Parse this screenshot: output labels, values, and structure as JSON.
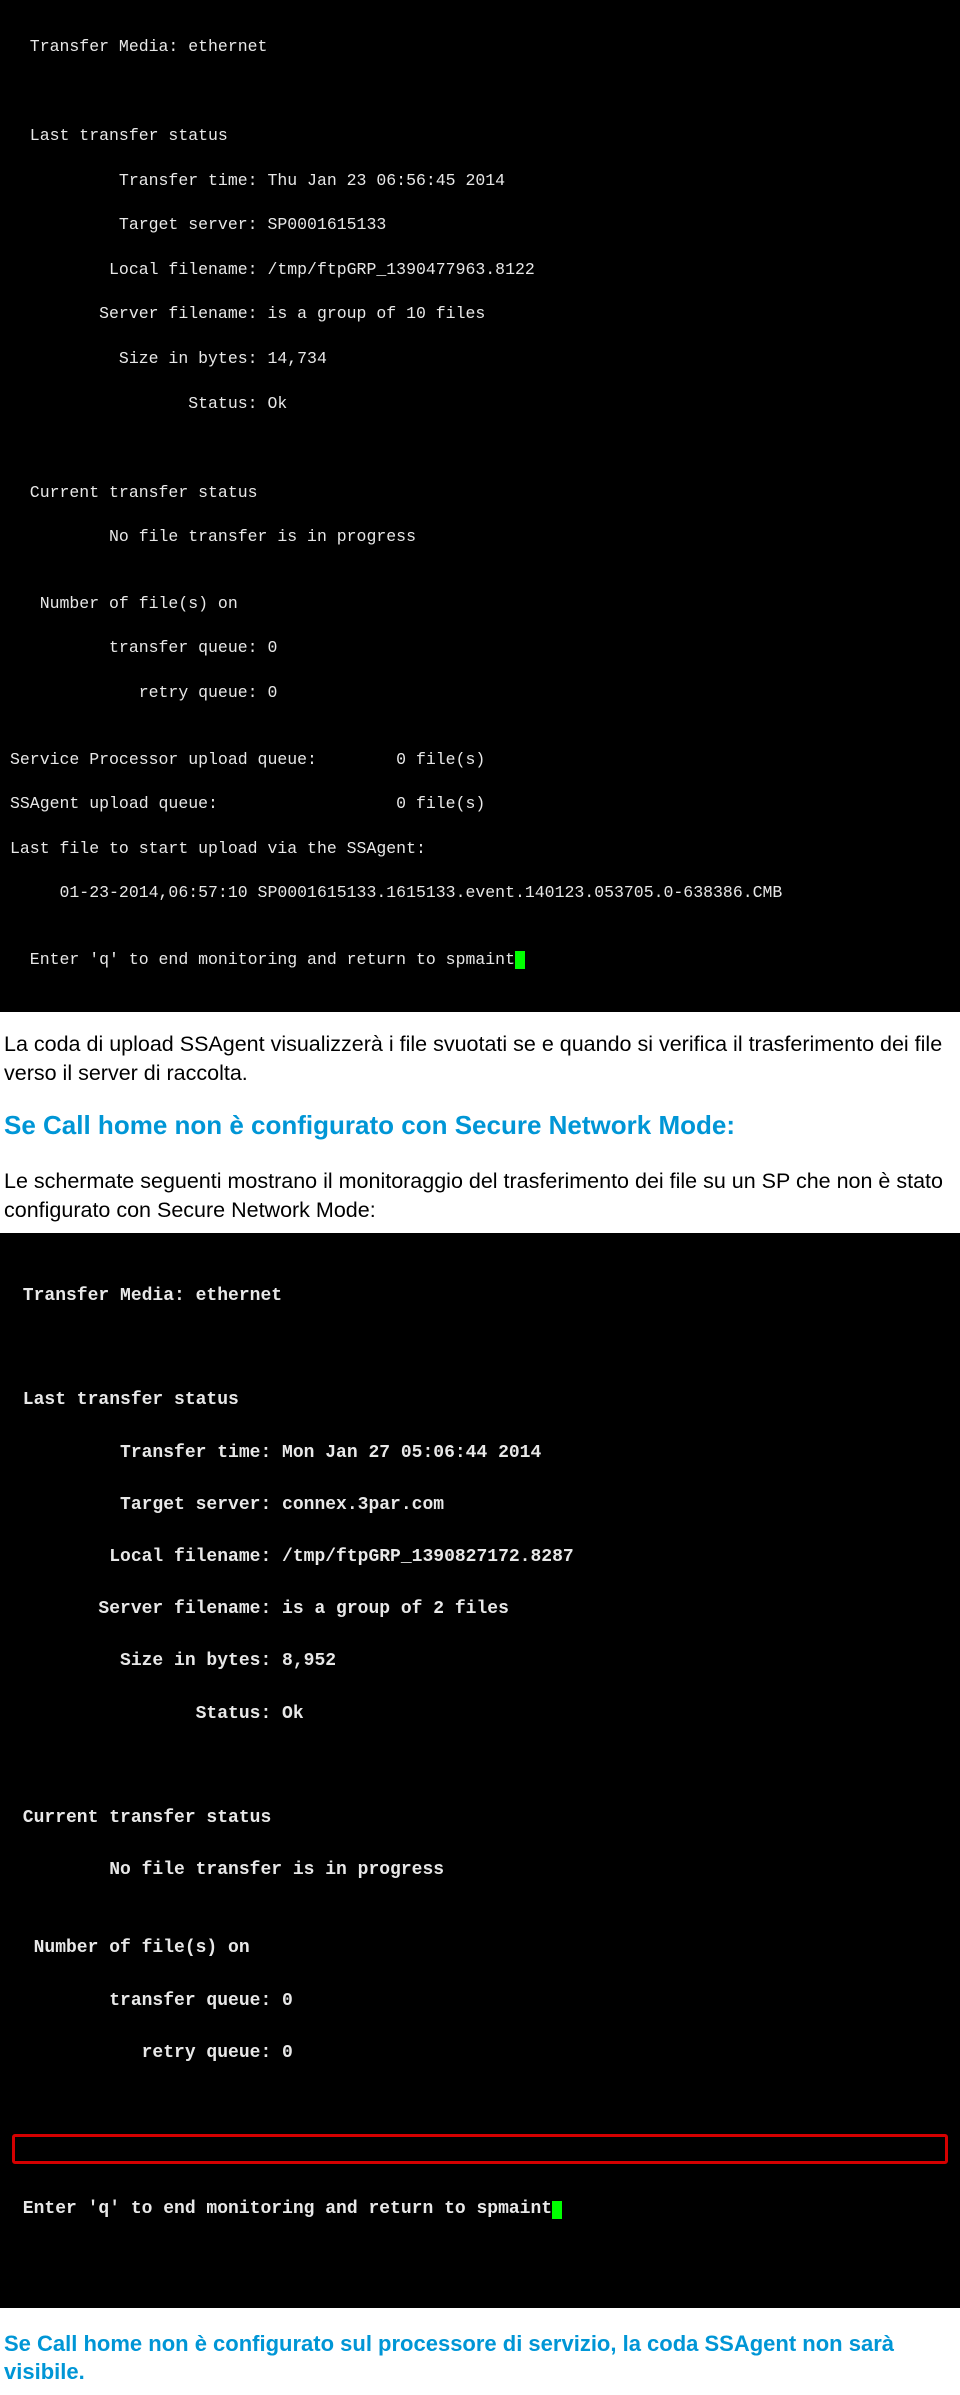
{
  "terminal1": {
    "rows": [
      "  Transfer Media: ethernet",
      "",
      "",
      "  Last transfer status",
      "           Transfer time: Thu Jan 23 06:56:45 2014",
      "           Target server: SP0001615133",
      "          Local filename: /tmp/ftpGRP_1390477963.8122",
      "         Server filename: is a group of 10 files",
      "           Size in bytes: 14,734",
      "                  Status: Ok",
      "",
      "",
      "  Current transfer status",
      "          No file transfer is in progress",
      "",
      "   Number of file(s) on",
      "          transfer queue: 0",
      "             retry queue: 0",
      "",
      "Service Processor upload queue:        0 file(s)",
      "SSAgent upload queue:                  0 file(s)",
      "Last file to start upload via the SSAgent:",
      "     01-23-2014,06:57:10 SP0001615133.1615133.event.140123.053705.0-638386.CMB",
      ""
    ],
    "prompt": "  Enter 'q' to end monitoring and return to spmaint"
  },
  "paragraph1": "La coda di upload SSAgent visualizzerà i file svuotati se e quando si verifica il trasferimento dei file verso il server di raccolta.",
  "heading1": "Se Call home non è configurato con Secure Network Mode:",
  "paragraph2": "Le schermate seguenti mostrano il monitoraggio del trasferimento dei file su un SP che non è stato configurato con Secure Network Mode:",
  "terminal2": {
    "rows": [
      " Transfer Media: ethernet",
      "",
      "",
      " Last transfer status",
      "          Transfer time: Mon Jan 27 05:06:44 2014",
      "          Target server: connex.3par.com",
      "         Local filename: /tmp/ftpGRP_1390827172.8287",
      "        Server filename: is a group of 2 files",
      "          Size in bytes: 8,952",
      "                 Status: Ok",
      "",
      "",
      " Current transfer status",
      "         No file transfer is in progress",
      "",
      "  Number of file(s) on",
      "         transfer queue: 0",
      "            retry queue: 0"
    ],
    "prompt": " Enter 'q' to end monitoring and return to spmaint"
  },
  "note1": "Se Call home non è configurato sul processore di servizio, la coda SSAgent non sarà visibile."
}
